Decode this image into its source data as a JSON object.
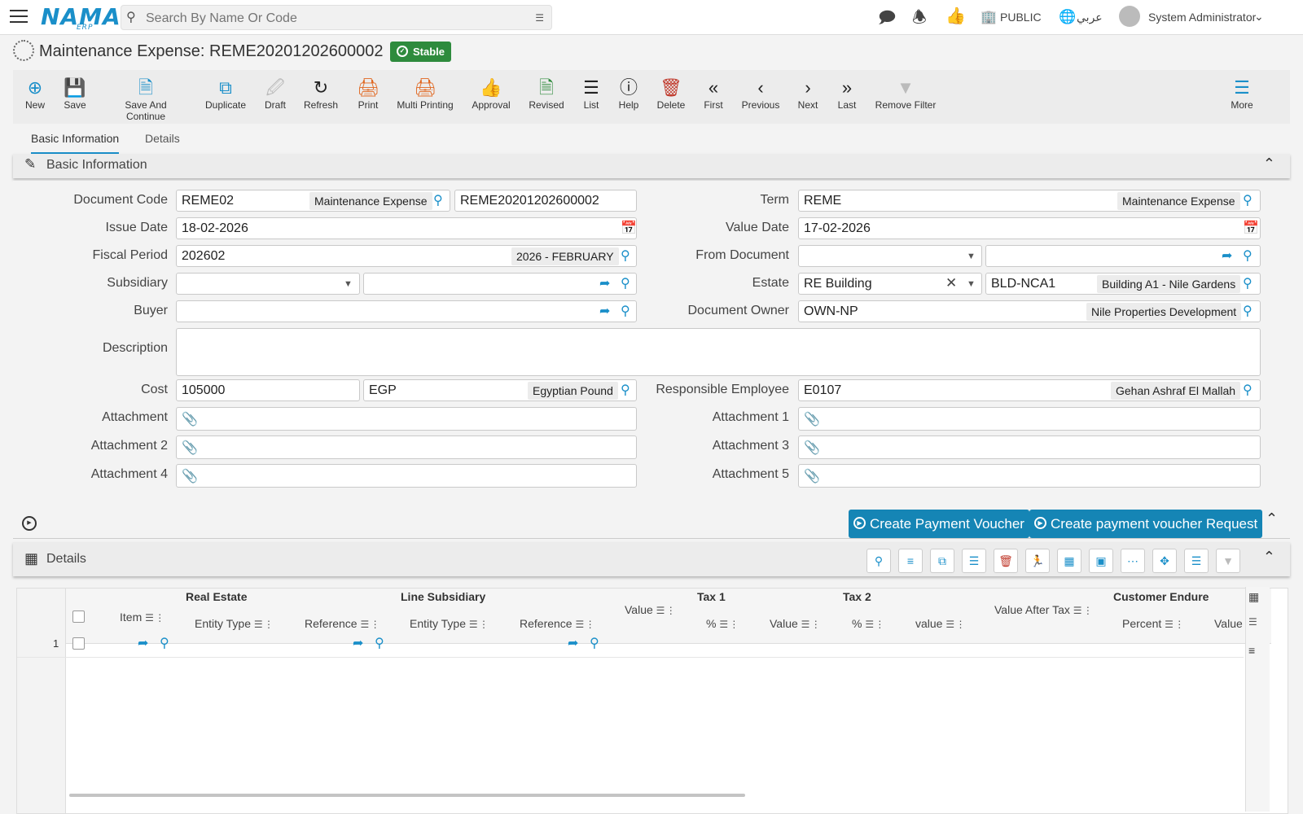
{
  "header": {
    "search_placeholder": "Search By Name Or Code",
    "logo": "NAMA",
    "logo_sub": "ERP",
    "public_label": "PUBLIC",
    "language_label": "عربي",
    "user_name": "System Administrator"
  },
  "page": {
    "title": "Maintenance Expense: REME20201202600002",
    "status": "Stable"
  },
  "toolbar": {
    "new": "New",
    "save": "Save",
    "save_continue": "Save And Continue",
    "duplicate": "Duplicate",
    "draft": "Draft",
    "refresh": "Refresh",
    "print": "Print",
    "multi_printing": "Multi Printing",
    "approval": "Approval",
    "revised": "Revised",
    "list": "List",
    "help": "Help",
    "delete": "Delete",
    "first": "First",
    "previous": "Previous",
    "next": "Next",
    "last": "Last",
    "remove_filter": "Remove Filter",
    "more": "More"
  },
  "tabs": {
    "basic": "Basic Information",
    "details": "Details"
  },
  "section": {
    "basic": "Basic Information",
    "details": "Details"
  },
  "form": {
    "document_code_label": "Document Code",
    "document_code": "REME02",
    "document_code_desc": "Maintenance Expense",
    "document_number": "REME20201202600002",
    "term_label": "Term",
    "term": "REME",
    "term_desc": "Maintenance Expense",
    "issue_date_label": "Issue Date",
    "issue_date": "18-02-2026",
    "value_date_label": "Value Date",
    "value_date": "17-02-2026",
    "fiscal_period_label": "Fiscal Period",
    "fiscal_period": "202602",
    "fiscal_period_desc": "2026 - FEBRUARY",
    "from_document_label": "From Document",
    "subsidiary_label": "Subsidiary",
    "estate_label": "Estate",
    "estate": "RE Building",
    "estate_code": "BLD-NCA1",
    "estate_desc": "Building A1 - Nile Gardens",
    "buyer_label": "Buyer",
    "document_owner_label": "Document Owner",
    "document_owner": "OWN-NP",
    "document_owner_desc": "Nile Properties Development",
    "description_label": "Description",
    "cost_label": "Cost",
    "cost": "105000",
    "currency": "EGP",
    "currency_desc": "Egyptian Pound",
    "responsible_label": "Responsible Employee",
    "responsible": "E0107",
    "responsible_desc": "Gehan Ashraf El Mallah",
    "attachment_label": "Attachment",
    "attachment1_label": "Attachment 1",
    "attachment2_label": "Attachment 2",
    "attachment3_label": "Attachment 3",
    "attachment4_label": "Attachment 4",
    "attachment5_label": "Attachment 5"
  },
  "actions": {
    "create_voucher": "Create Payment Voucher",
    "create_voucher_request": "Create payment voucher Request"
  },
  "grid": {
    "group_real_estate": "Real Estate",
    "group_line_subsidiary": "Line Subsidiary",
    "group_tax1": "Tax 1",
    "group_tax2": "Tax 2",
    "group_customer_endure": "Customer Endure",
    "col_item": "Item",
    "col_entity_type": "Entity Type",
    "col_reference": "Reference",
    "col_value": "Value",
    "col_percent_sym": "%",
    "col_value_lower": "value",
    "col_value_after_tax": "Value After Tax",
    "col_percent": "Percent",
    "row_num": "1"
  }
}
